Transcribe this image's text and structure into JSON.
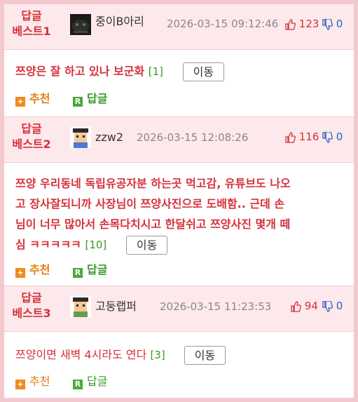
{
  "comments": [
    {
      "badge_line1": "답글",
      "badge_line2": "베스트1",
      "avatar": "dark-creature-avatar",
      "nickname": "중이B아리",
      "timestamp": "2026-03-15 09:12:46",
      "upvotes": "123",
      "downvotes": "0",
      "text": "쯔양은 잘 하고 있나 보군화",
      "reply_count": "[1]",
      "move_label": "이동",
      "recommend_label": "추천",
      "reply_label": "답글"
    },
    {
      "badge_line1": "답글",
      "badge_line2": "베스트2",
      "avatar": "pixel-person-avatar",
      "nickname": "zzw2",
      "timestamp": "2026-03-15 12:08:26",
      "upvotes": "116",
      "downvotes": "0",
      "text_line1": "쯔양 우리동네 독립유공자분 하는곳 먹고감, 유튜브도 나오",
      "text_line2": "고 장사잘되니까 사장님이 쯔양사진으로 도배함.. 근데 손",
      "text_line3": "님이 너무 많아서 손목다치시고 한달쉬고 쯔양사진 몇개 떼",
      "text_line4": "심 ㅋㅋㅋㅋㅋ",
      "reply_count": "[10]",
      "move_label": "이동",
      "recommend_label": "추천",
      "reply_label": "답글"
    },
    {
      "badge_line1": "답글",
      "badge_line2": "베스트3",
      "avatar": "pixel-person-avatar",
      "nickname": "고둥랩퍼",
      "timestamp": "2026-03-15 11:23:53",
      "upvotes": "94",
      "downvotes": "0",
      "text": "쯔양이면 새벽 4시라도 연다",
      "reply_count": "[3]",
      "move_label": "이동",
      "recommend_label": "추천",
      "reply_label": "답글"
    }
  ],
  "colors": {
    "accent_red": "#d6303a",
    "header_pink": "#fde9eb",
    "border_pink": "#f3c9cd",
    "reply_green": "#3a9a2a",
    "recommend_orange": "#e67e10",
    "down_blue": "#2a5fc6"
  },
  "icons": {
    "thumb_up": "thumbs-up-icon",
    "thumb_down": "thumbs-down-icon",
    "plus": "plus-square-icon",
    "reply": "r-square-icon"
  }
}
